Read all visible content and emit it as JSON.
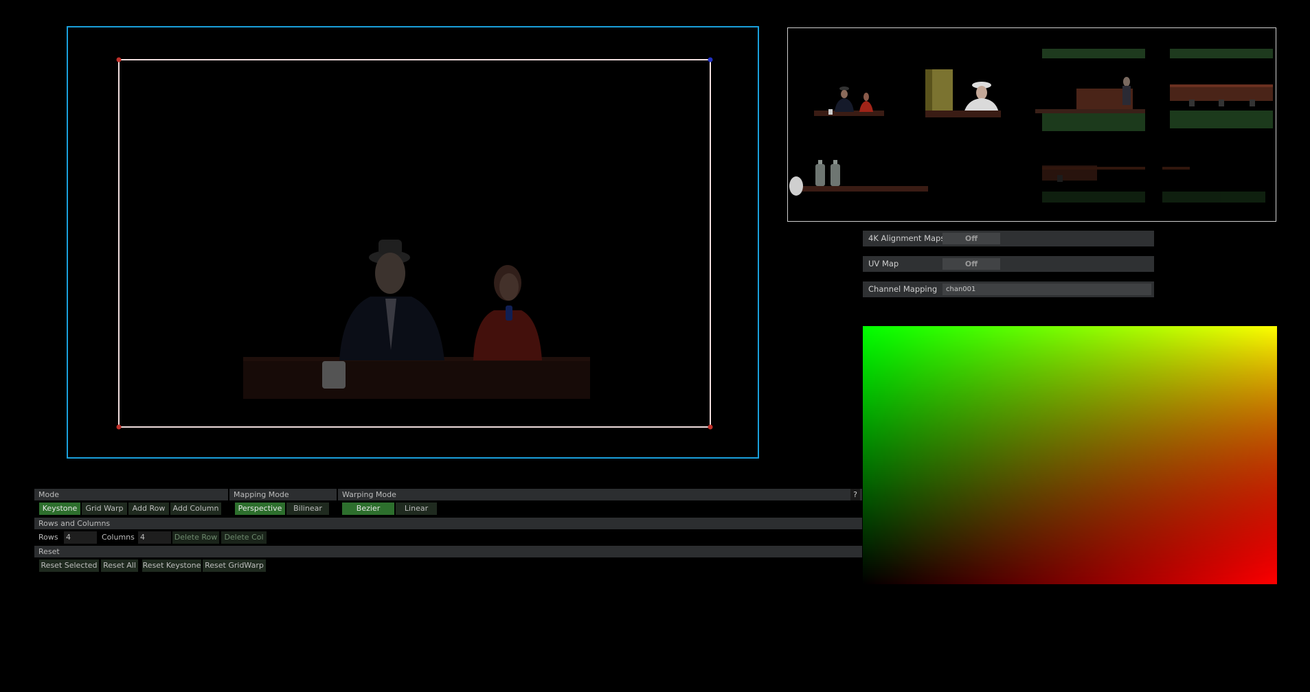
{
  "viewer": {
    "accent": "#1aa0dc",
    "corner_colors": [
      "#c0302a",
      "#2030c0",
      "#c0302a",
      "#c0302a"
    ]
  },
  "right_panel": {
    "rows": [
      {
        "label": "4K Alignment Maps",
        "value": "Off"
      },
      {
        "label": "UV Map",
        "value": "Off"
      },
      {
        "label": "Channel Mapping",
        "value": "chan001"
      }
    ]
  },
  "controls": {
    "mode": {
      "header": "Mode",
      "buttons": [
        "Keystone",
        "Grid Warp",
        "Add Row",
        "Add Column"
      ],
      "active": "Keystone"
    },
    "mapping_mode": {
      "header": "Mapping Mode",
      "buttons": [
        "Perspective",
        "Bilinear"
      ],
      "active": "Perspective"
    },
    "warping_mode": {
      "header": "Warping Mode",
      "buttons": [
        "Bezier",
        "Linear"
      ],
      "active": "Bezier",
      "help": "?"
    },
    "rows_columns": {
      "header": "Rows and Columns",
      "rows_label": "Rows",
      "rows_value": "4",
      "columns_label": "Columns",
      "columns_value": "4",
      "delete_row": "Delete Row",
      "delete_col": "Delete Col"
    },
    "reset": {
      "header": "Reset",
      "buttons": [
        "Reset Selected",
        "Reset All",
        "Reset Keystone",
        "Reset GridWarp"
      ]
    }
  },
  "colors": {
    "active_button": "#2d6f2d",
    "header_bg": "#2c2e30",
    "gradient_tl": "#00ff00",
    "gradient_tr": "#ffff00",
    "gradient_br": "#ff0000"
  }
}
